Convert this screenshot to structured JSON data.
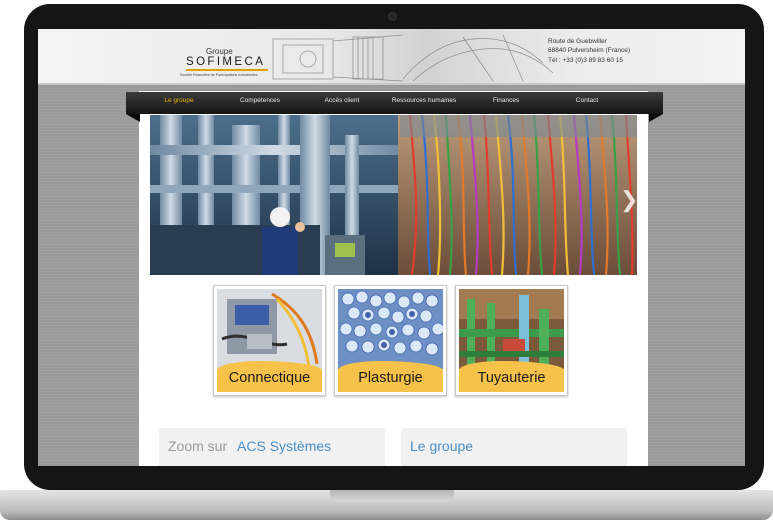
{
  "site": {
    "logo": {
      "groupe": "Groupe",
      "name": "SOFIMECA",
      "tagline": "Société Financière de Participations Industrielles"
    },
    "address": [
      "Route de Guebwiller",
      "68840 Pulversheim (France)",
      "Tél : +33 (0)3 89 83 60 15"
    ],
    "nav": [
      {
        "label": "Le groupe",
        "active": true
      },
      {
        "label": "Compétences",
        "active": false
      },
      {
        "label": "Accès client",
        "active": false
      },
      {
        "label": "Ressources humaines",
        "active": false
      },
      {
        "label": "Finances",
        "active": false
      },
      {
        "label": "Contact",
        "active": false
      }
    ],
    "hero": {
      "next_icon": "chevron-right-icon",
      "next_glyph": "❯"
    },
    "tiles": [
      {
        "label": "Connectique",
        "image": "cable-assembly-image"
      },
      {
        "label": "Plasturgie",
        "image": "plastic-pellets-image"
      },
      {
        "label": "Tuyauterie",
        "image": "industrial-piping-image"
      }
    ],
    "boxes": {
      "zoom_prefix": "Zoom sur",
      "zoom_name": "ACS Systèmes",
      "groupe_title": "Le groupe"
    },
    "colors": {
      "accent": "#f0b400",
      "tile_band": "#f7c24a",
      "link_blue": "#4a8fc7",
      "nav_bg": "#1f1f1f"
    }
  }
}
